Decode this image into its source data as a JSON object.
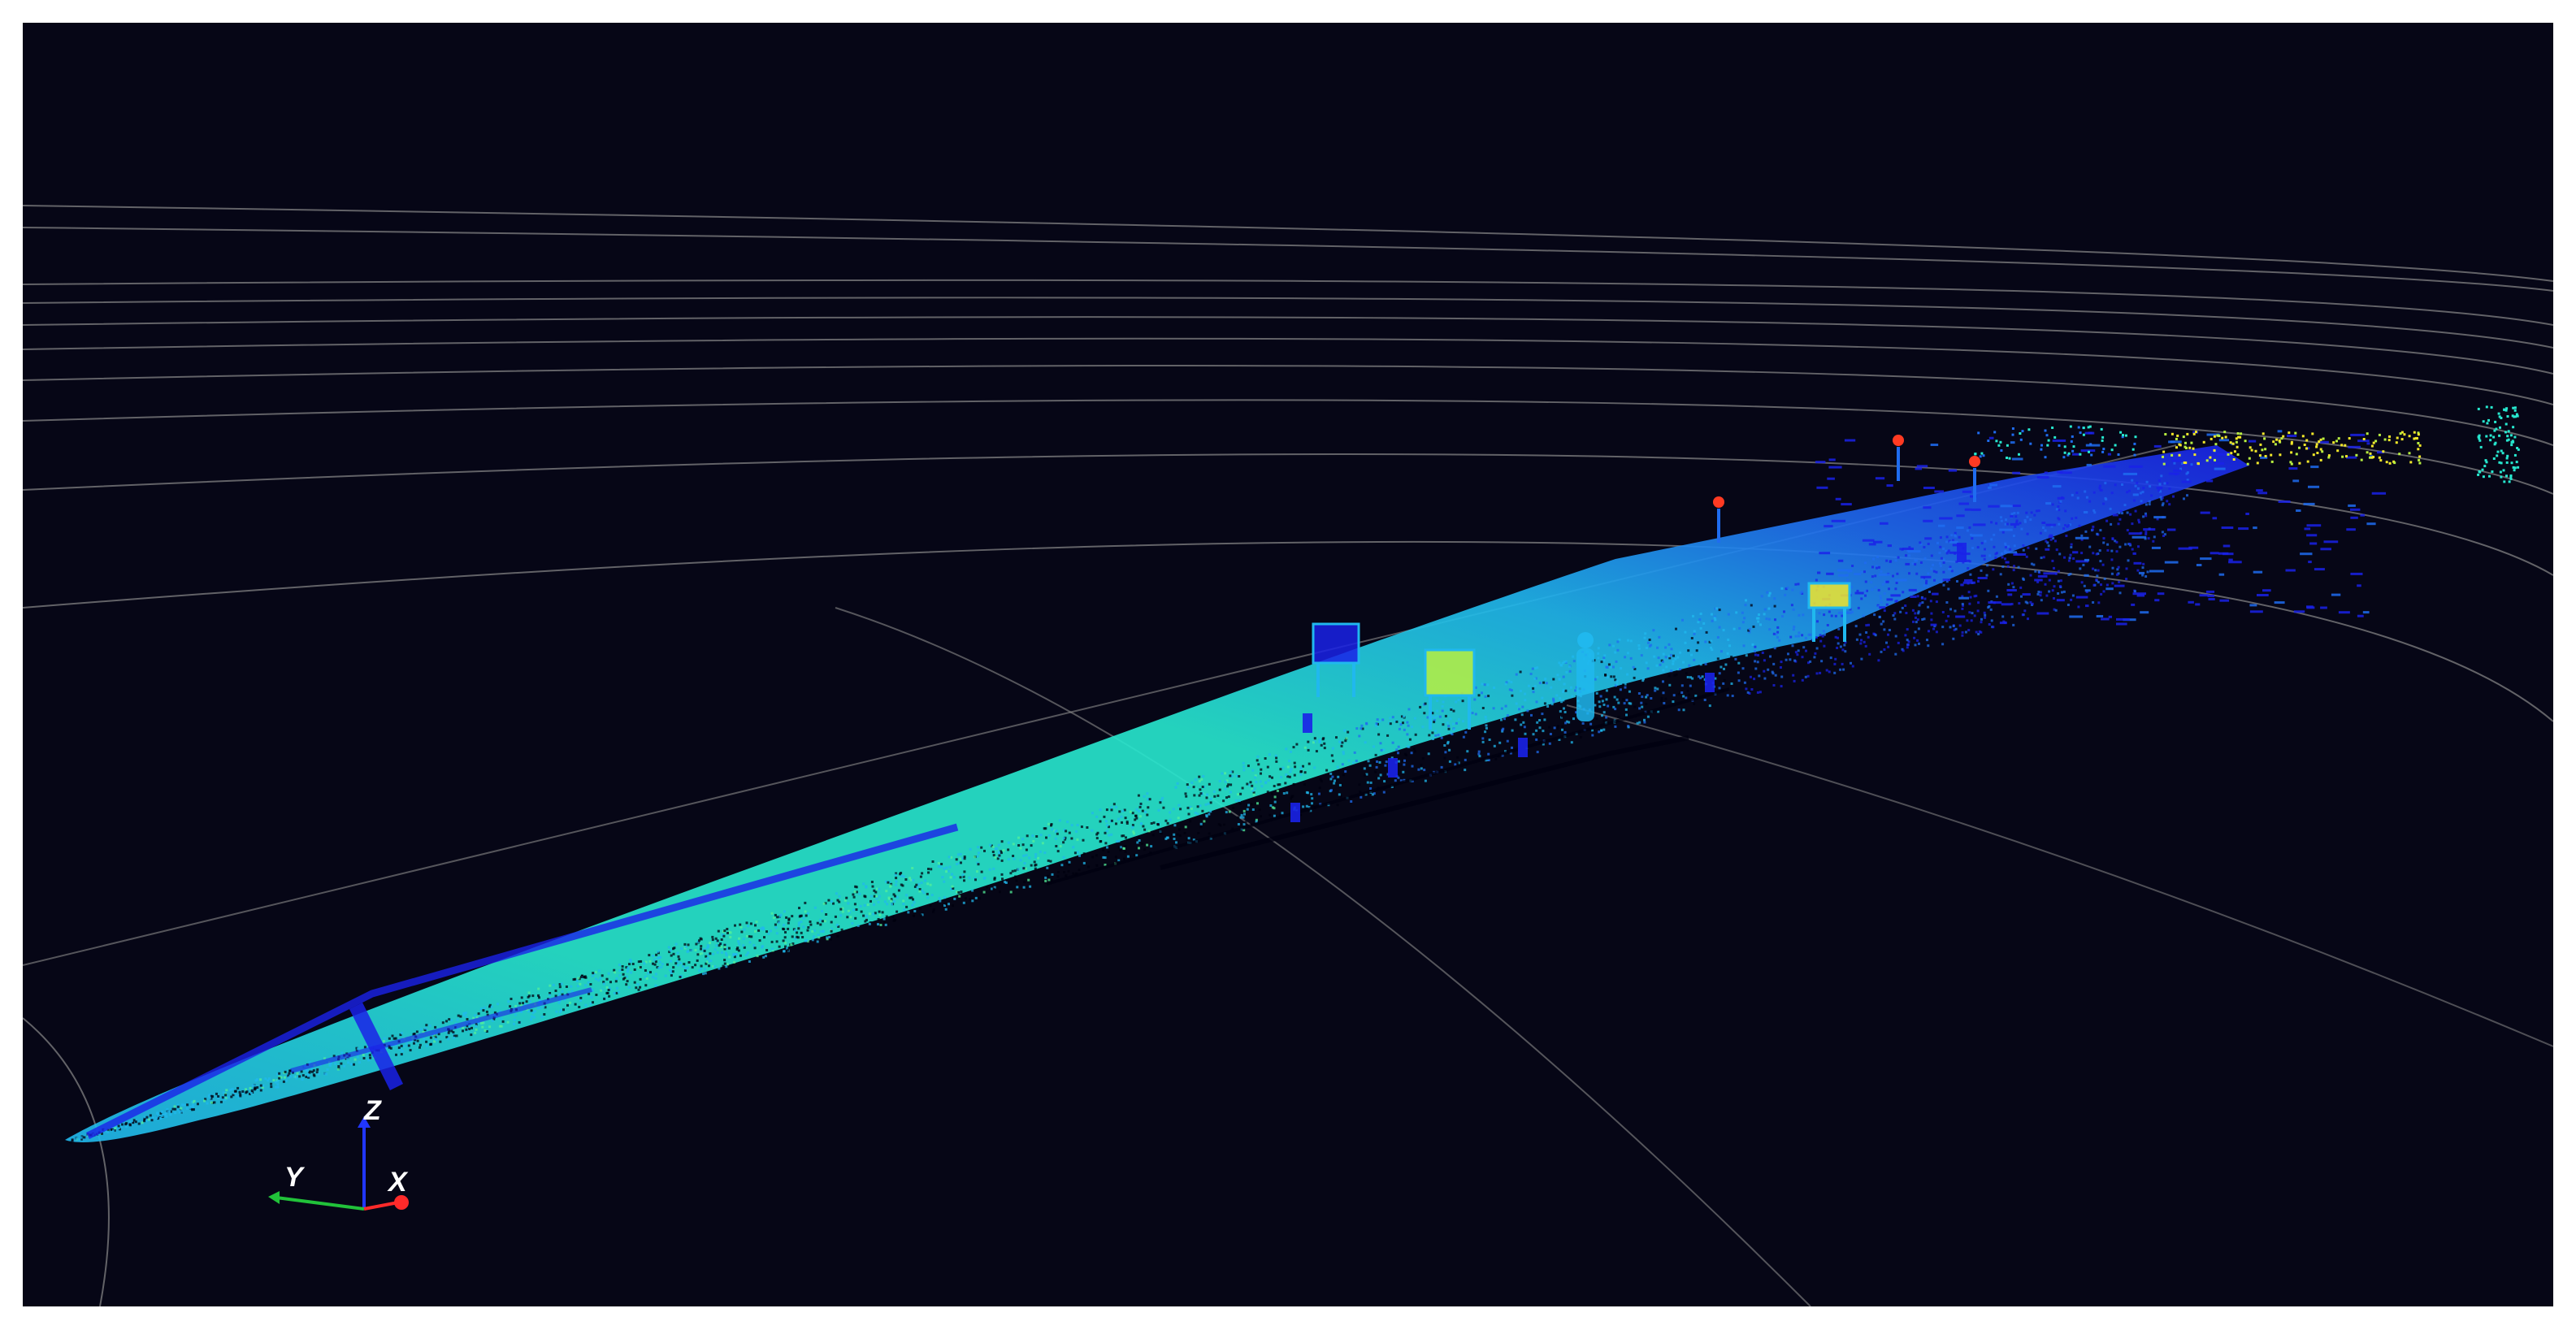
{
  "viewport": {
    "background": "#060616",
    "grid_color": "#8a8a8a",
    "colormap": [
      "#1a22e8",
      "#1f6cf0",
      "#20b8ee",
      "#27e8cf",
      "#53f09a",
      "#b8f040",
      "#f2e82a",
      "#ff3a22"
    ]
  },
  "axes_gizmo": {
    "z": {
      "label": "Z",
      "color": "#2136ff"
    },
    "y": {
      "label": "Y",
      "color": "#21c23a"
    },
    "x": {
      "label": "X",
      "color": "#ff2a2a"
    }
  }
}
